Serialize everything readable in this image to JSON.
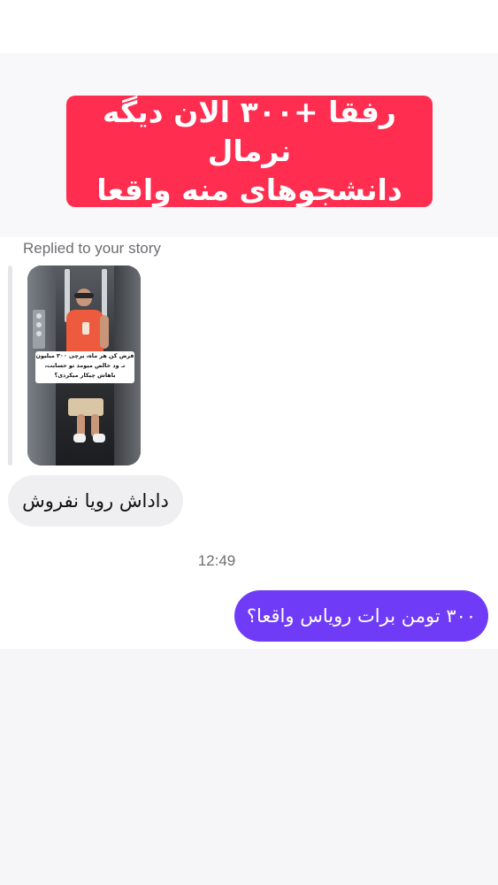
{
  "story_banner": {
    "line1": "رفقا +۳۰۰ الان دیگه نرمال",
    "line2": "دانشجوهای منه واقعا",
    "color": "#ff2d4f"
  },
  "reply_context": {
    "label": "Replied to your story",
    "story_caption": "فرض کن هر ماه، یرچی ۳۰۰ میلیون تـ ود خالص میومد تو حسابت، باهاش چیکار میکردی؟"
  },
  "messages": {
    "incoming_text": "داداش رویا نفروش",
    "timestamp": "12:49",
    "outgoing_text": "۳۰۰ تومن برات رویاس واقعا؟",
    "outgoing_color": "#6f3bf6",
    "incoming_color": "#efeff1"
  }
}
